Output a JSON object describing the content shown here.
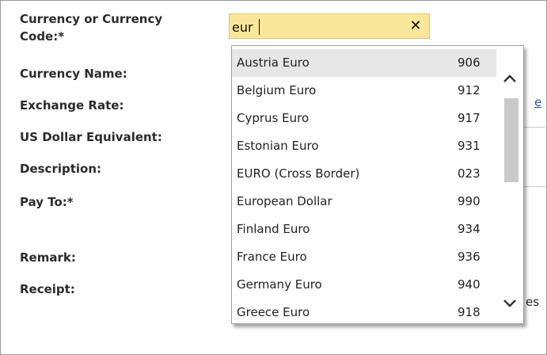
{
  "form": {
    "labels": {
      "currency_l1": "Currency or Currency",
      "currency_l2": "Code:*",
      "currency_name": "Currency Name:",
      "exchange_rate": "Exchange Rate:",
      "usd_equivalent": "US Dollar Equivalent:",
      "description": "Description:",
      "pay_to": "Pay To:*",
      "remark": "Remark:",
      "receipt": "Receipt:"
    },
    "behind_fragments": {
      "link_fragment": "e",
      "text_fragment": "es"
    }
  },
  "currency_combo": {
    "value": "eur",
    "clear_glyph": "✕"
  },
  "dropdown": {
    "items": [
      {
        "name": "Austria Euro",
        "code": "906"
      },
      {
        "name": "Belgium Euro",
        "code": "912"
      },
      {
        "name": "Cyprus Euro",
        "code": "917"
      },
      {
        "name": "Estonian Euro",
        "code": "931"
      },
      {
        "name": "EURO (Cross Border)",
        "code": "023"
      },
      {
        "name": "European Dollar",
        "code": "990"
      },
      {
        "name": "Finland Euro",
        "code": "934"
      },
      {
        "name": "France Euro",
        "code": "936"
      },
      {
        "name": "Germany Euro",
        "code": "940"
      },
      {
        "name": "Greece Euro",
        "code": "918"
      }
    ],
    "highlighted_index": 0,
    "scroll_position_fraction": 0.3
  },
  "colors": {
    "combo_background": "#fbe79a",
    "highlight_row": "#e7e7e7",
    "label_text": "#2b2b2b",
    "scroll_thumb": "#c9c9c9",
    "link": "#1a5aa6"
  }
}
